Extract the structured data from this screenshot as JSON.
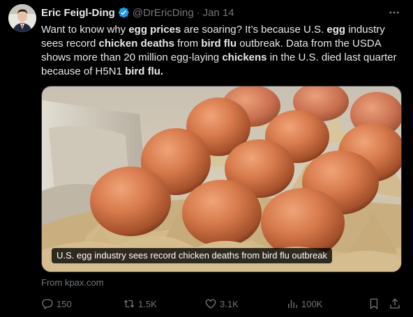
{
  "author": {
    "display_name": "Eric Feigl-Ding",
    "handle": "@DrEricDing",
    "separator": "·",
    "date": "Jan 14",
    "verified": true
  },
  "tweet": {
    "segments": [
      {
        "text": "Want to know why ",
        "bold": false
      },
      {
        "text": "egg prices",
        "bold": true
      },
      {
        "text": " are soaring? It’s because U.S. ",
        "bold": false
      },
      {
        "text": "egg",
        "bold": true
      },
      {
        "text": " industry sees record ",
        "bold": false
      },
      {
        "text": "chicken deaths",
        "bold": true
      },
      {
        "text": " from ",
        "bold": false
      },
      {
        "text": "bird flu",
        "bold": true
      },
      {
        "text": " outbreak. Data from the USDA shows more than 20 million egg-laying ",
        "bold": false
      },
      {
        "text": "chickens",
        "bold": true
      },
      {
        "text": " in the U.S. died last quarter because of H5N1 ",
        "bold": false
      },
      {
        "text": "bird flu.",
        "bold": true
      }
    ]
  },
  "card": {
    "image_icon": "eggs-in-carton-photo",
    "caption": "U.S. egg industry sees record chicken deaths from bird flu outbreak",
    "source": "From kpax.com"
  },
  "actions": {
    "replies": "150",
    "reposts": "1.5K",
    "likes": "3.1K",
    "views": "100K",
    "icons": [
      "reply-icon",
      "repost-icon",
      "like-icon",
      "views-icon",
      "bookmark-icon",
      "share-icon"
    ]
  },
  "colors": {
    "background": "#000000",
    "text": "#e7e9ea",
    "muted": "#71767b",
    "verified": "#1d9bf0"
  }
}
